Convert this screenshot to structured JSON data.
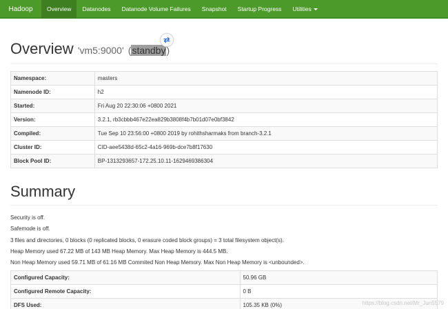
{
  "navbar": {
    "brand": "Hadoop",
    "items": [
      {
        "label": "Overview",
        "active": true
      },
      {
        "label": "Datanodes"
      },
      {
        "label": "Datanode Volume Failures"
      },
      {
        "label": "Snapshot"
      },
      {
        "label": "Startup Progress"
      },
      {
        "label": "Utilities"
      }
    ]
  },
  "overview": {
    "title": "Overview",
    "host": "'vm5:9000'",
    "state_open": "(",
    "state": "standby",
    "state_close": ")",
    "swap_icon": "swap-icon",
    "rows": [
      {
        "key": "Namespace:",
        "value": "masters"
      },
      {
        "key": "Namenode ID:",
        "value": "h2"
      },
      {
        "key": "Started:",
        "value": "Fri Aug 20 22:30:06 +0800 2021"
      },
      {
        "key": "Version:",
        "value": "3.2.1, rb3cbbb467e22ea829b3808f4b7b01d07e0bf3842"
      },
      {
        "key": "Compiled:",
        "value": "Tue Sep 10 23:56:00 +0800 2019 by rohithsharmaks from branch-3.2.1"
      },
      {
        "key": "Cluster ID:",
        "value": "CID-aee5438d-65c2-4a16-969b-dce7b8f17630"
      },
      {
        "key": "Block Pool ID:",
        "value": "BP-1313293657-172.25.10.11-1629469386304"
      }
    ]
  },
  "summary": {
    "title": "Summary",
    "lines": [
      "Security is off.",
      "Safemode is off.",
      "3 files and directories, 0 blocks (0 replicated blocks, 0 erasure coded block groups) = 3 total filesystem object(s).",
      "Heap Memory used 67.22 MB of 143 MB Heap Memory. Max Heap Memory is 444.5 MB.",
      "Non Heap Memory used 59.71 MB of 61.16 MB Commited Non Heap Memory. Max Non Heap Memory is <unbounded>."
    ],
    "rows": [
      {
        "key": "Configured Capacity:",
        "value": "50.96 GB"
      },
      {
        "key": "Configured Remote Capacity:",
        "value": "0 B"
      },
      {
        "key": "DFS Used:",
        "value": "105.35 KB (0%)"
      }
    ]
  },
  "watermark": "https://blog.csdn.net/Mr_Jun5579"
}
